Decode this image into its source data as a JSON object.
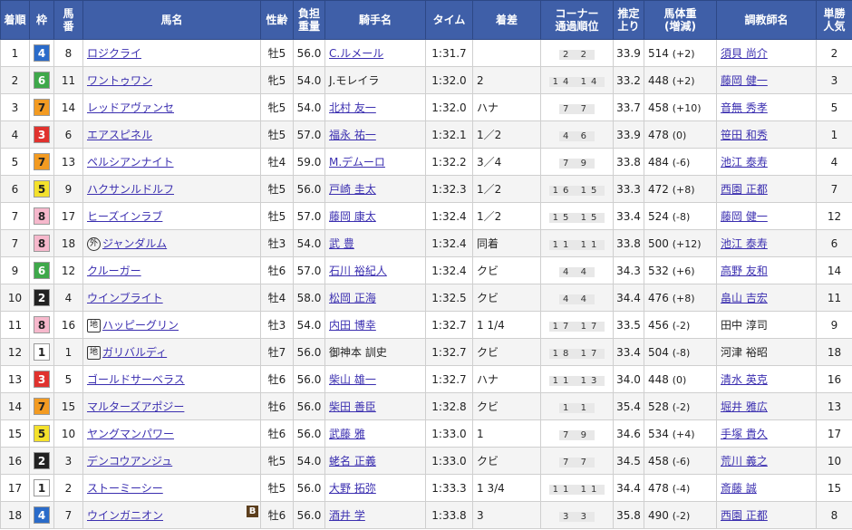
{
  "headers": {
    "rank": [
      "着順"
    ],
    "waku": [
      "枠"
    ],
    "num": [
      "馬",
      "番"
    ],
    "horse": [
      "馬名"
    ],
    "sexage": [
      "性齢"
    ],
    "weight": [
      "負担",
      "重量"
    ],
    "jockey": [
      "騎手名"
    ],
    "time": [
      "タイム"
    ],
    "margin": [
      "着差"
    ],
    "corner": [
      "コーナー",
      "通過順位"
    ],
    "agari": [
      "推定",
      "上り"
    ],
    "body": [
      "馬体重",
      "(増減)"
    ],
    "trainer": [
      "調教師名"
    ],
    "odds": [
      "単勝",
      "人気"
    ]
  },
  "waku_colors": {
    "1": {
      "bg": "#ffffff",
      "fg": "#222222"
    },
    "2": {
      "bg": "#222222",
      "fg": "#ffffff"
    },
    "3": {
      "bg": "#e0322e",
      "fg": "#ffffff"
    },
    "4": {
      "bg": "#2a6bc9",
      "fg": "#ffffff"
    },
    "5": {
      "bg": "#f4e12c",
      "fg": "#222222"
    },
    "6": {
      "bg": "#3ea84a",
      "fg": "#ffffff"
    },
    "7": {
      "bg": "#f39b22",
      "fg": "#222222"
    },
    "8": {
      "bg": "#f6b8cc",
      "fg": "#222222"
    }
  },
  "rows": [
    {
      "rank": "1",
      "waku": "4",
      "num": "8",
      "mark": "",
      "horse": "ロジクライ",
      "blinker": "",
      "sexage": "牡5",
      "weight": "56.0",
      "jockey": "C.ルメール",
      "jockey_link": true,
      "time": "1:31.7",
      "margin": "",
      "corner": "2 2",
      "agari": "33.9",
      "body": "514",
      "delta": "(+2)",
      "trainer": "須貝 尚介",
      "trainer_link": true,
      "pop": "2"
    },
    {
      "rank": "2",
      "waku": "6",
      "num": "11",
      "mark": "",
      "horse": "ワントゥワン",
      "blinker": "",
      "sexage": "牝5",
      "weight": "54.0",
      "jockey": "J.モレイラ",
      "jockey_link": false,
      "time": "1:32.0",
      "margin": "2",
      "corner": "14 14",
      "agari": "33.2",
      "body": "448",
      "delta": "(+2)",
      "trainer": "藤岡 健一",
      "trainer_link": true,
      "pop": "3"
    },
    {
      "rank": "3",
      "waku": "7",
      "num": "14",
      "mark": "",
      "horse": "レッドアヴァンセ",
      "blinker": "",
      "sexage": "牝5",
      "weight": "54.0",
      "jockey": "北村 友一",
      "jockey_link": true,
      "time": "1:32.0",
      "margin": "ハナ",
      "corner": "7 7",
      "agari": "33.7",
      "body": "458",
      "delta": "(+10)",
      "trainer": "音無 秀孝",
      "trainer_link": true,
      "pop": "5"
    },
    {
      "rank": "4",
      "waku": "3",
      "num": "6",
      "mark": "",
      "horse": "エアスピネル",
      "blinker": "",
      "sexage": "牡5",
      "weight": "57.0",
      "jockey": "福永 祐一",
      "jockey_link": true,
      "time": "1:32.1",
      "margin": "1／2",
      "corner": "4 6",
      "agari": "33.9",
      "body": "478",
      "delta": "(0)",
      "trainer": "笹田 和秀",
      "trainer_link": true,
      "pop": "1"
    },
    {
      "rank": "5",
      "waku": "7",
      "num": "13",
      "mark": "",
      "horse": "ペルシアンナイト",
      "blinker": "",
      "sexage": "牡4",
      "weight": "59.0",
      "jockey": "M.デムーロ",
      "jockey_link": true,
      "time": "1:32.2",
      "margin": "3／4",
      "corner": "7 9",
      "agari": "33.8",
      "body": "484",
      "delta": "(-6)",
      "trainer": "池江 泰寿",
      "trainer_link": true,
      "pop": "4"
    },
    {
      "rank": "6",
      "waku": "5",
      "num": "9",
      "mark": "",
      "horse": "ハクサンルドルフ",
      "blinker": "",
      "sexage": "牡5",
      "weight": "56.0",
      "jockey": "戸崎 圭太",
      "jockey_link": true,
      "time": "1:32.3",
      "margin": "1／2",
      "corner": "16 15",
      "agari": "33.3",
      "body": "472",
      "delta": "(+8)",
      "trainer": "西園 正都",
      "trainer_link": true,
      "pop": "7"
    },
    {
      "rank": "7",
      "waku": "8",
      "num": "17",
      "mark": "",
      "horse": "ヒーズインラブ",
      "blinker": "",
      "sexage": "牡5",
      "weight": "57.0",
      "jockey": "藤岡 康太",
      "jockey_link": true,
      "time": "1:32.4",
      "margin": "1／2",
      "corner": "15 15",
      "agari": "33.4",
      "body": "524",
      "delta": "(-8)",
      "trainer": "藤岡 健一",
      "trainer_link": true,
      "pop": "12"
    },
    {
      "rank": "7",
      "waku": "8",
      "num": "18",
      "mark": "外",
      "horse": "ジャンダルム",
      "blinker": "",
      "sexage": "牡3",
      "weight": "54.0",
      "jockey": "武 豊",
      "jockey_link": true,
      "time": "1:32.4",
      "margin": "同着",
      "corner": "11 11",
      "agari": "33.8",
      "body": "500",
      "delta": "(+12)",
      "trainer": "池江 泰寿",
      "trainer_link": true,
      "pop": "6"
    },
    {
      "rank": "9",
      "waku": "6",
      "num": "12",
      "mark": "",
      "horse": "クルーガー",
      "blinker": "",
      "sexage": "牡6",
      "weight": "57.0",
      "jockey": "石川 裕紀人",
      "jockey_link": true,
      "time": "1:32.4",
      "margin": "クビ",
      "corner": "4 4",
      "agari": "34.3",
      "body": "532",
      "delta": "(+6)",
      "trainer": "高野 友和",
      "trainer_link": true,
      "pop": "14"
    },
    {
      "rank": "10",
      "waku": "2",
      "num": "4",
      "mark": "",
      "horse": "ウインブライト",
      "blinker": "",
      "sexage": "牡4",
      "weight": "58.0",
      "jockey": "松岡 正海",
      "jockey_link": true,
      "time": "1:32.5",
      "margin": "クビ",
      "corner": "4 4",
      "agari": "34.4",
      "body": "476",
      "delta": "(+8)",
      "trainer": "畠山 吉宏",
      "trainer_link": true,
      "pop": "11"
    },
    {
      "rank": "11",
      "waku": "8",
      "num": "16",
      "mark": "地",
      "horse": "ハッピーグリン",
      "blinker": "",
      "sexage": "牡3",
      "weight": "54.0",
      "jockey": "内田 博幸",
      "jockey_link": true,
      "time": "1:32.7",
      "margin": "1 1/4",
      "corner": "17 17",
      "agari": "33.5",
      "body": "456",
      "delta": "(-2)",
      "trainer": "田中 淳司",
      "trainer_link": false,
      "pop": "9"
    },
    {
      "rank": "12",
      "waku": "1",
      "num": "1",
      "mark": "地",
      "horse": "ガリバルディ",
      "blinker": "",
      "sexage": "牡7",
      "weight": "56.0",
      "jockey": "御神本 訓史",
      "jockey_link": false,
      "time": "1:32.7",
      "margin": "クビ",
      "corner": "18 17",
      "agari": "33.4",
      "body": "504",
      "delta": "(-8)",
      "trainer": "河津 裕昭",
      "trainer_link": false,
      "pop": "18"
    },
    {
      "rank": "13",
      "waku": "3",
      "num": "5",
      "mark": "",
      "horse": "ゴールドサーベラス",
      "blinker": "",
      "sexage": "牡6",
      "weight": "56.0",
      "jockey": "柴山 雄一",
      "jockey_link": true,
      "time": "1:32.7",
      "margin": "ハナ",
      "corner": "11 13",
      "agari": "34.0",
      "body": "448",
      "delta": "(0)",
      "trainer": "清水 英克",
      "trainer_link": true,
      "pop": "16"
    },
    {
      "rank": "14",
      "waku": "7",
      "num": "15",
      "mark": "",
      "horse": "マルターズアポジー",
      "blinker": "",
      "sexage": "牡6",
      "weight": "56.0",
      "jockey": "柴田 善臣",
      "jockey_link": true,
      "time": "1:32.8",
      "margin": "クビ",
      "corner": "1 1",
      "agari": "35.4",
      "body": "528",
      "delta": "(-2)",
      "trainer": "堀井 雅広",
      "trainer_link": true,
      "pop": "13"
    },
    {
      "rank": "15",
      "waku": "5",
      "num": "10",
      "mark": "",
      "horse": "ヤングマンパワー",
      "blinker": "",
      "sexage": "牡6",
      "weight": "56.0",
      "jockey": "武藤 雅",
      "jockey_link": true,
      "time": "1:33.0",
      "margin": "1",
      "corner": "7 9",
      "agari": "34.6",
      "body": "534",
      "delta": "(+4)",
      "trainer": "手塚 貴久",
      "trainer_link": true,
      "pop": "17"
    },
    {
      "rank": "16",
      "waku": "2",
      "num": "3",
      "mark": "",
      "horse": "デンコウアンジュ",
      "blinker": "",
      "sexage": "牝5",
      "weight": "54.0",
      "jockey": "蛯名 正義",
      "jockey_link": true,
      "time": "1:33.0",
      "margin": "クビ",
      "corner": "7 7",
      "agari": "34.5",
      "body": "458",
      "delta": "(-6)",
      "trainer": "荒川 義之",
      "trainer_link": true,
      "pop": "10"
    },
    {
      "rank": "17",
      "waku": "1",
      "num": "2",
      "mark": "",
      "horse": "ストーミーシー",
      "blinker": "",
      "sexage": "牡5",
      "weight": "56.0",
      "jockey": "大野 拓弥",
      "jockey_link": true,
      "time": "1:33.3",
      "margin": "1 3/4",
      "corner": "11 11",
      "agari": "34.4",
      "body": "478",
      "delta": "(-4)",
      "trainer": "斎藤 誠",
      "trainer_link": true,
      "pop": "15"
    },
    {
      "rank": "18",
      "waku": "4",
      "num": "7",
      "mark": "",
      "horse": "ウインガニオン",
      "blinker": "B",
      "sexage": "牡6",
      "weight": "56.0",
      "jockey": "酒井 学",
      "jockey_link": true,
      "time": "1:33.8",
      "margin": "3",
      "corner": "3 3",
      "agari": "35.8",
      "body": "490",
      "delta": "(-2)",
      "trainer": "西園 正都",
      "trainer_link": true,
      "pop": "8"
    }
  ]
}
